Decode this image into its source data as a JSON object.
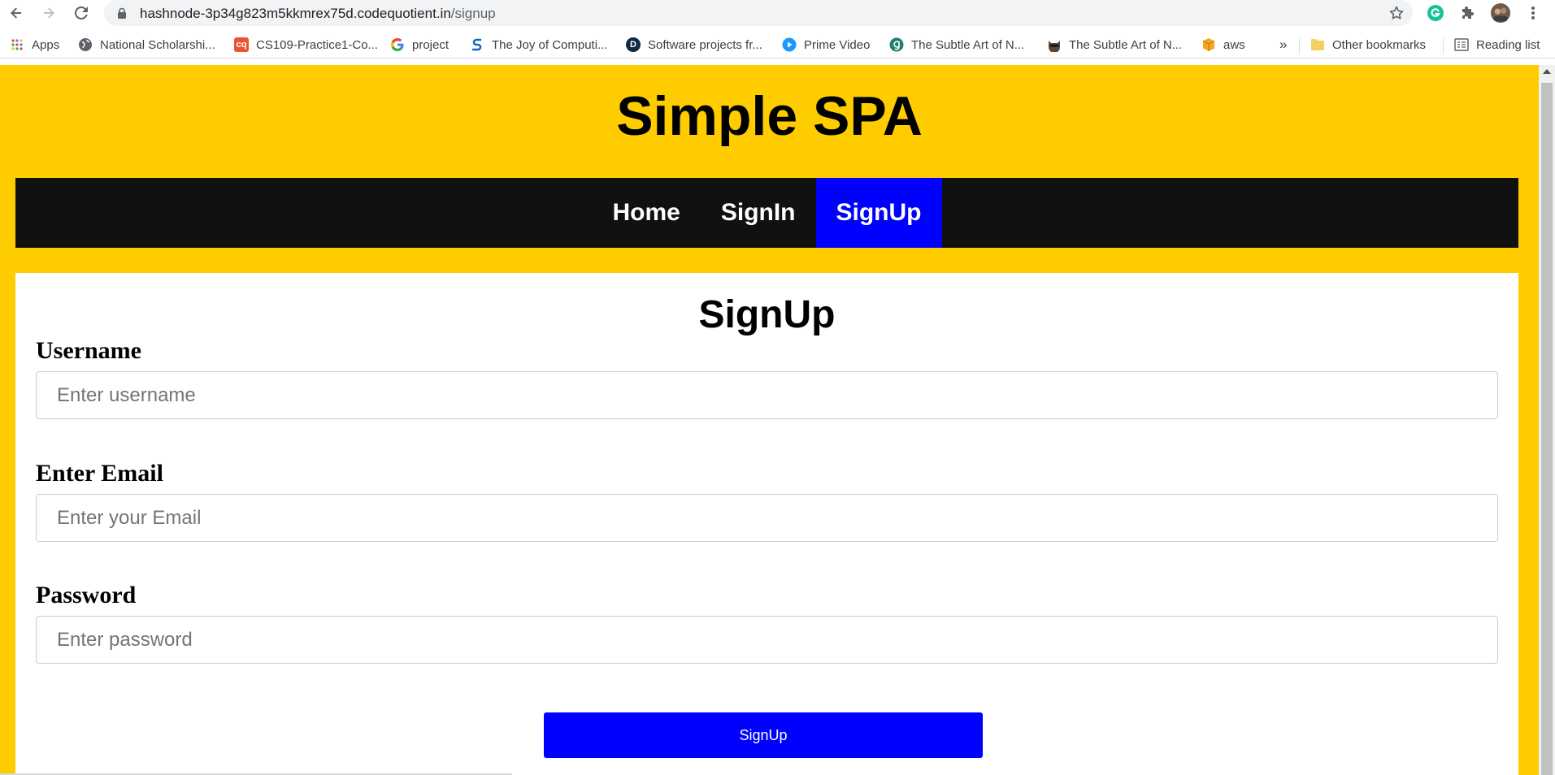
{
  "browser": {
    "url_host": "hashnode-3p34g823m5kkmrex75d.codequotient.in",
    "url_path": "/signup",
    "bookmarks": [
      {
        "label": "Apps",
        "icon": "apps-grid-icon"
      },
      {
        "label": "National Scholarshi...",
        "icon": "globe-icon"
      },
      {
        "label": "CS109-Practice1-Co...",
        "icon": "codequotient-icon",
        "icon_text": "cq"
      },
      {
        "label": "project",
        "icon": "google-icon"
      },
      {
        "label": "The Joy of Computi...",
        "icon": "swayam-icon"
      },
      {
        "label": "Software projects fr...",
        "icon": "d-logo-icon",
        "icon_text": "D"
      },
      {
        "label": "Prime Video",
        "icon": "prime-video-icon"
      },
      {
        "label": "The Subtle Art of N...",
        "icon": "goodreads-icon"
      },
      {
        "label": "The Subtle Art of N...",
        "icon": "cat-face-icon"
      },
      {
        "label": "aws",
        "icon": "aws-box-icon"
      }
    ],
    "more_label": "»",
    "other_bookmarks_label": "Other bookmarks",
    "reading_list_label": "Reading list"
  },
  "site": {
    "title": "Simple SPA",
    "nav": [
      {
        "label": "Home",
        "active": false
      },
      {
        "label": "SignIn",
        "active": false
      },
      {
        "label": "SignUp",
        "active": true
      }
    ]
  },
  "form": {
    "title": "SignUp",
    "fields": [
      {
        "label": "Username",
        "placeholder": "Enter username",
        "value": ""
      },
      {
        "label": "Enter Email",
        "placeholder": "Enter your Email",
        "value": ""
      },
      {
        "label": "Password",
        "placeholder": "Enter password",
        "value": ""
      }
    ],
    "submit_label": "SignUp"
  },
  "colors": {
    "page_background": "#ffcc00",
    "navbar_background": "#111111",
    "accent": "#0000ff",
    "card_background": "#ffffff"
  }
}
